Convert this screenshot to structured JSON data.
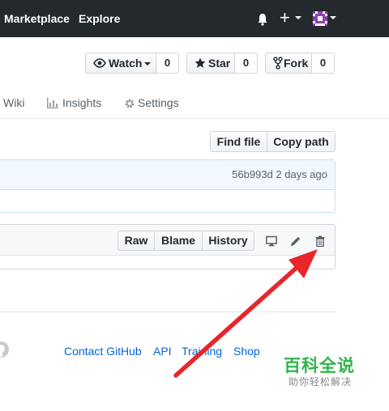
{
  "header": {
    "nav": [
      "Marketplace",
      "Explore"
    ],
    "icons": [
      "bell-icon",
      "plus-icon",
      "avatar"
    ]
  },
  "repo_actions": {
    "watch": {
      "label": "Watch",
      "count": "0",
      "icon": "eye-icon"
    },
    "star": {
      "label": "Star",
      "count": "0",
      "icon": "star-icon"
    },
    "fork": {
      "label": "Fork",
      "count": "0",
      "icon": "fork-icon"
    }
  },
  "tabs": [
    {
      "label": "Wiki",
      "icon": ""
    },
    {
      "label": "Insights",
      "icon": "graph-icon"
    },
    {
      "label": "Settings",
      "icon": "gear-icon"
    }
  ],
  "file_actions": {
    "find_file": "Find file",
    "copy_path": "Copy path"
  },
  "commit": {
    "meta": "56b993d 2 days ago"
  },
  "file_header": {
    "raw": "Raw",
    "blame": "Blame",
    "history": "History",
    "icons": [
      "desktop-icon",
      "pencil-icon",
      "trash-icon"
    ]
  },
  "footer": {
    "links": [
      "Contact GitHub",
      "API",
      "Training",
      "Shop"
    ]
  },
  "watermark": {
    "title": "百科全说",
    "subtitle": "助你轻松解决"
  },
  "colors": {
    "header_bg": "#24292e",
    "link": "#0366d6",
    "arrow": "#e8262b",
    "watermark": "#2fb34a"
  }
}
